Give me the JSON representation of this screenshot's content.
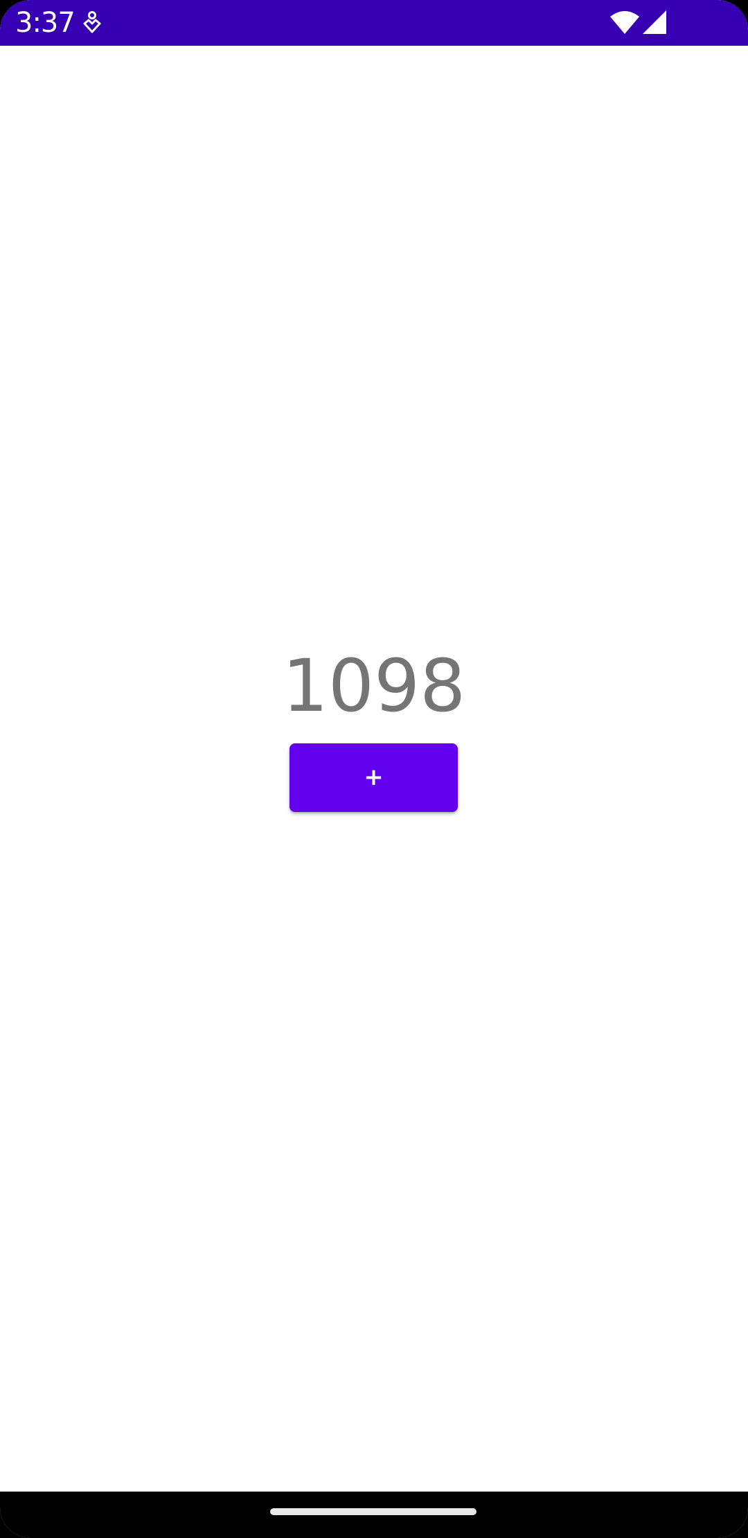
{
  "status_bar": {
    "time": "3:37",
    "icons": [
      "app-notification-icon",
      "wifi-icon",
      "cell-signal-icon"
    ],
    "background_color": "#3700b3"
  },
  "counter": {
    "value": "1098",
    "text_color": "#757575"
  },
  "increment_button": {
    "label": "+",
    "color": "#6200ee"
  },
  "navigation_bar": {
    "icons": [
      "home-gesture-handle"
    ]
  }
}
